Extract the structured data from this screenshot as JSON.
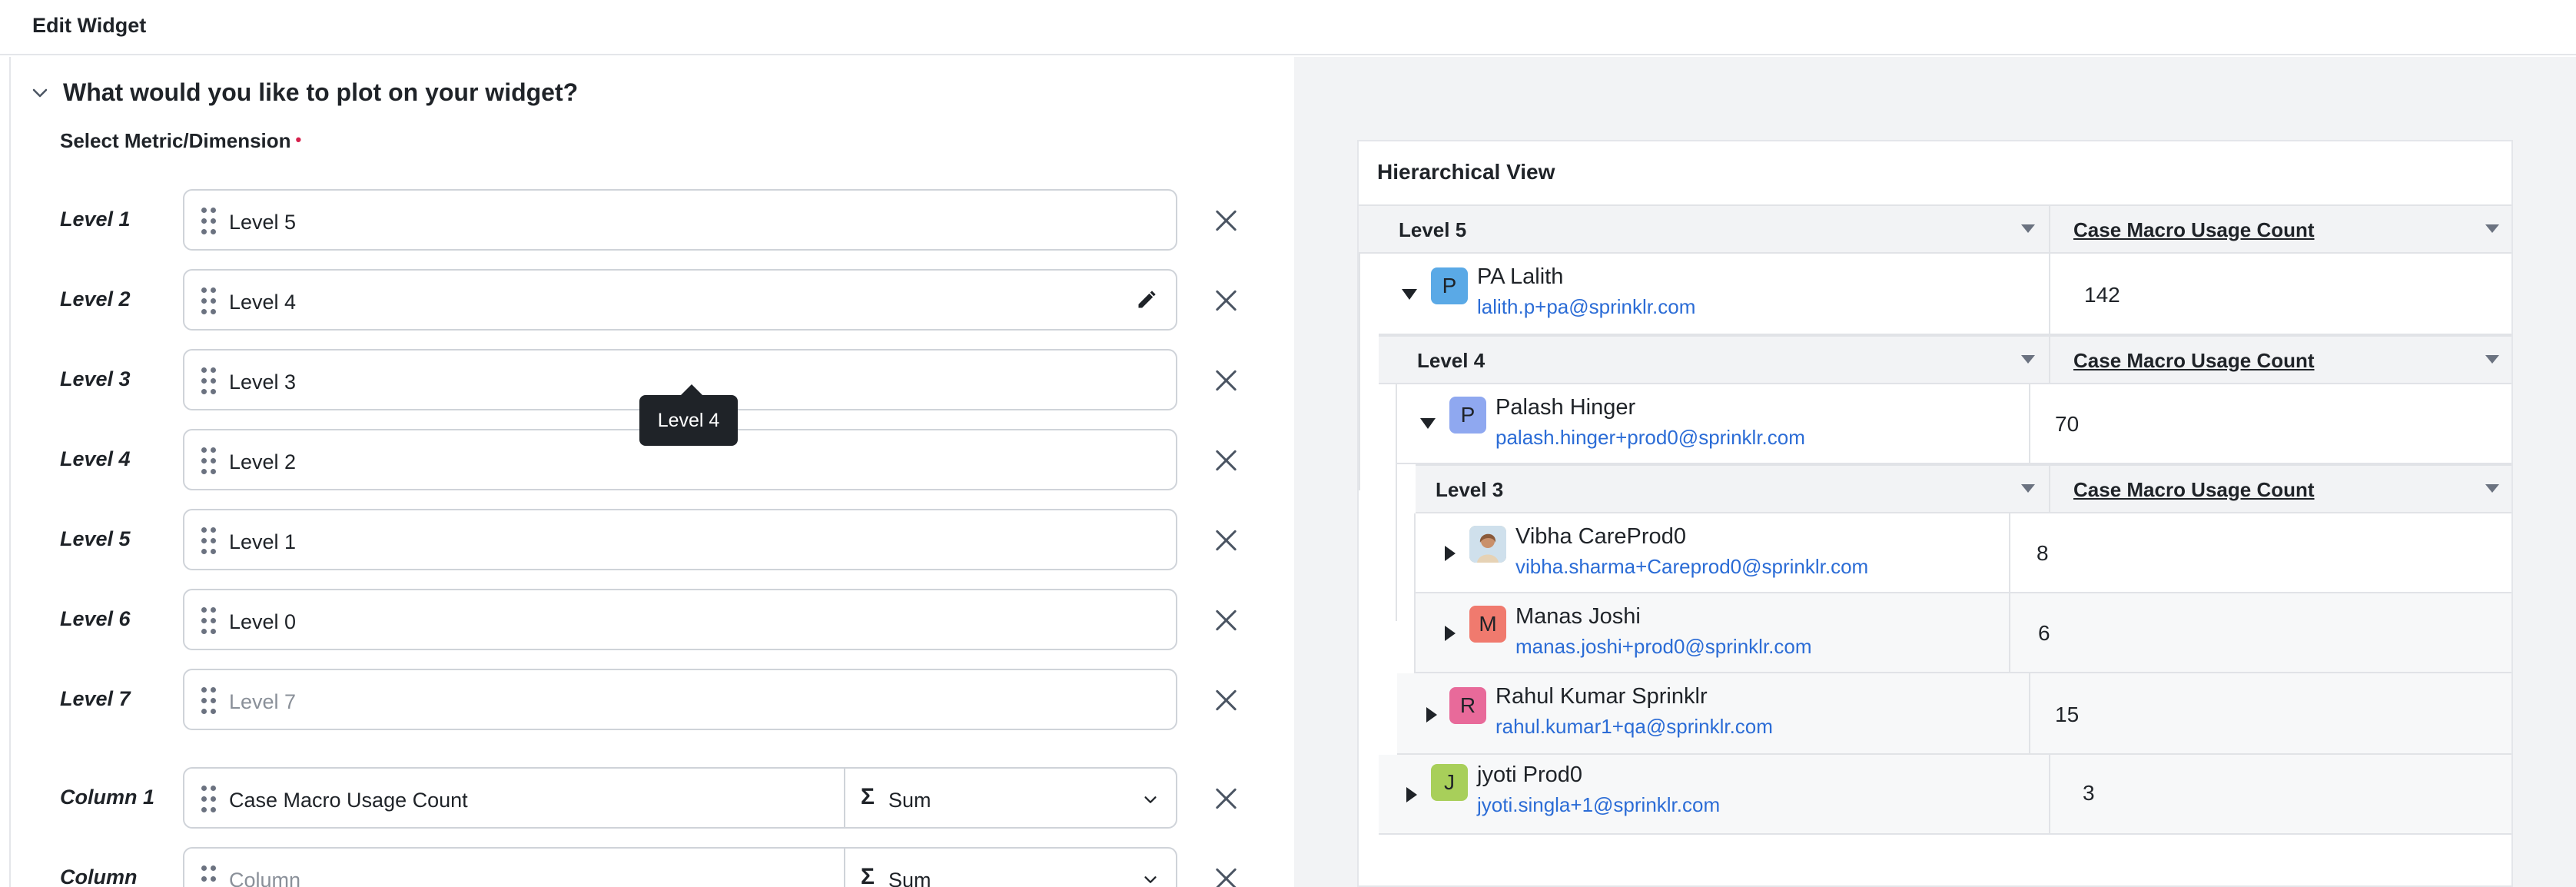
{
  "header": {
    "title": "Edit Widget"
  },
  "section": {
    "title": "What would you like to plot on your widget?",
    "select_label": "Select Metric/Dimension",
    "required_mark": "•"
  },
  "levels": [
    {
      "label": "Level 1",
      "value": "Level 5",
      "placeholder": false
    },
    {
      "label": "Level 2",
      "value": "Level 4",
      "placeholder": false
    },
    {
      "label": "Level 3",
      "value": "Level 3",
      "placeholder": false
    },
    {
      "label": "Level 4",
      "value": "Level 2",
      "placeholder": false
    },
    {
      "label": "Level 5",
      "value": "Level 1",
      "placeholder": false
    },
    {
      "label": "Level 6",
      "value": "Level 0",
      "placeholder": false
    },
    {
      "label": "Level 7",
      "value": "Level 7",
      "placeholder": true
    }
  ],
  "columns": [
    {
      "label": "Column 1",
      "value": "Case Macro Usage Count",
      "placeholder": false,
      "sigma": "Σ",
      "aggregation": "Sum"
    },
    {
      "label": "Column",
      "value": "Column",
      "placeholder": true,
      "sigma": "Σ",
      "aggregation": "Sum"
    }
  ],
  "tooltip": {
    "text": "Level 4"
  },
  "hierarchy": {
    "title": "Hierarchical View",
    "headers": [
      {
        "title": "Level 5",
        "metric": "Case Macro Usage Count"
      },
      {
        "title": "Level 4",
        "metric": "Case Macro Usage Count"
      },
      {
        "title": "Level 3",
        "metric": "Case Macro Usage Count"
      }
    ],
    "rows": [
      {
        "initial": "P",
        "name": "PA Lalith",
        "email": "lalith.p+pa@sprinklr.com",
        "value": "142",
        "expanded": true,
        "avatar_color": "#5aa9e6"
      },
      {
        "initial": "P",
        "name": "Palash Hinger",
        "email": "palash.hinger+prod0@sprinklr.com",
        "value": "70",
        "expanded": true,
        "avatar_color": "#8fa8f0"
      },
      {
        "initial": "",
        "name": "Vibha CareProd0",
        "email": "vibha.sharma+Careprod0@sprinklr.com",
        "value": "8",
        "expanded": false,
        "avatar_color": "#d8c6a8"
      },
      {
        "initial": "M",
        "name": "Manas Joshi",
        "email": "manas.joshi+prod0@sprinklr.com",
        "value": "6",
        "expanded": false,
        "avatar_color": "#f07a6e"
      },
      {
        "initial": "R",
        "name": "Rahul Kumar Sprinklr",
        "email": "rahul.kumar1+qa@sprinklr.com",
        "value": "15",
        "expanded": false,
        "avatar_color": "#e86a9a"
      },
      {
        "initial": "J",
        "name": "jyoti Prod0",
        "email": "jyoti.singla+1@sprinklr.com",
        "value": "3",
        "expanded": false,
        "avatar_color": "#a8cf5a"
      }
    ]
  }
}
